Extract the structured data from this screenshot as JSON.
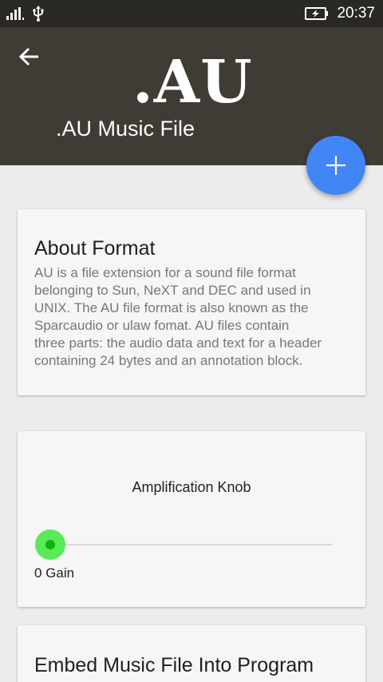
{
  "status_bar": {
    "time": "20:37",
    "icons": [
      "signal-icon",
      "usb-icon",
      "battery-charging-icon"
    ]
  },
  "header": {
    "logo_text": ".AU",
    "title": ".AU Music File",
    "back_icon": "arrow-left-icon"
  },
  "fab": {
    "icon": "plus-icon",
    "color": "#4285f4"
  },
  "about": {
    "heading": "About Format",
    "lines": [
      "AU is a file extension for a sound file format",
      "belonging to Sun, NeXT and DEC and used in",
      "UNIX. The AU file format is also known as the",
      "Sparcaudio or ulaw fomat. AU files contain",
      "three parts: the audio data and text for a header",
      "containing 24 bytes and an annotation block."
    ]
  },
  "amplification": {
    "label": "Amplification Knob",
    "value": 0,
    "value_label": "0 Gain",
    "thumb_color": "#58ea58"
  },
  "embed": {
    "heading": "Embed Music File Into Program"
  },
  "colors": {
    "status_bar": "#2a2824",
    "header": "#3f3c36",
    "background": "#ececec",
    "card": "#f6f6f6"
  }
}
